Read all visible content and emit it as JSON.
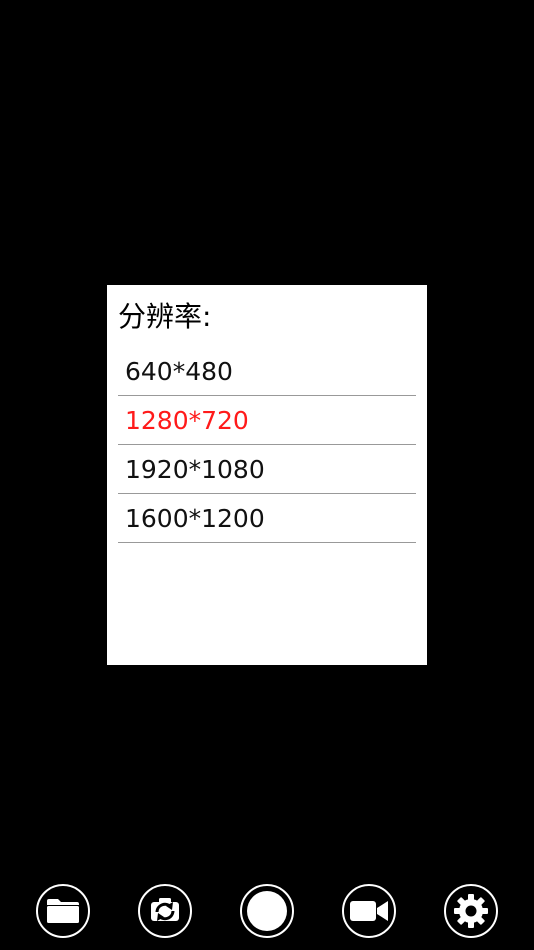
{
  "dialog": {
    "title": "分辨率:",
    "options": [
      {
        "label": "640*480",
        "selected": false
      },
      {
        "label": "1280*720",
        "selected": true
      },
      {
        "label": "1920*1080",
        "selected": false
      },
      {
        "label": "1600*1200",
        "selected": false
      }
    ],
    "selected_color": "#ff1a1a"
  },
  "toolbar": {
    "buttons": [
      {
        "name": "folder-button",
        "icon": "folder-icon"
      },
      {
        "name": "switch-camera-button",
        "icon": "switch-camera-icon"
      },
      {
        "name": "shutter-button",
        "icon": "shutter-icon"
      },
      {
        "name": "record-video-button",
        "icon": "video-camera-icon"
      },
      {
        "name": "settings-button",
        "icon": "gear-icon"
      }
    ]
  }
}
